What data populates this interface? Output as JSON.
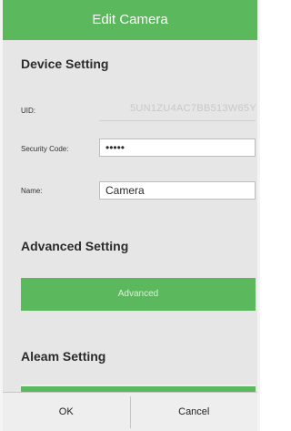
{
  "title_bar": {
    "title": "Edit Camera"
  },
  "device_setting": {
    "heading": "Device Setting",
    "uid_label": "UID:",
    "uid_value": "5UN1ZU4AC7BB513W65Y",
    "security_code_label": "Security Code:",
    "security_code_value": "•••••",
    "name_label": "Name:",
    "name_value": "Camera"
  },
  "advanced_setting": {
    "heading": "Advanced Setting",
    "button_label": "Advanced"
  },
  "alarm_setting": {
    "heading": "Aleam Setting"
  },
  "bottom_bar": {
    "ok_label": "OK",
    "cancel_label": "Cancel"
  },
  "colors": {
    "accent_green": "#5cb85c",
    "background": "#e6e6e6"
  }
}
